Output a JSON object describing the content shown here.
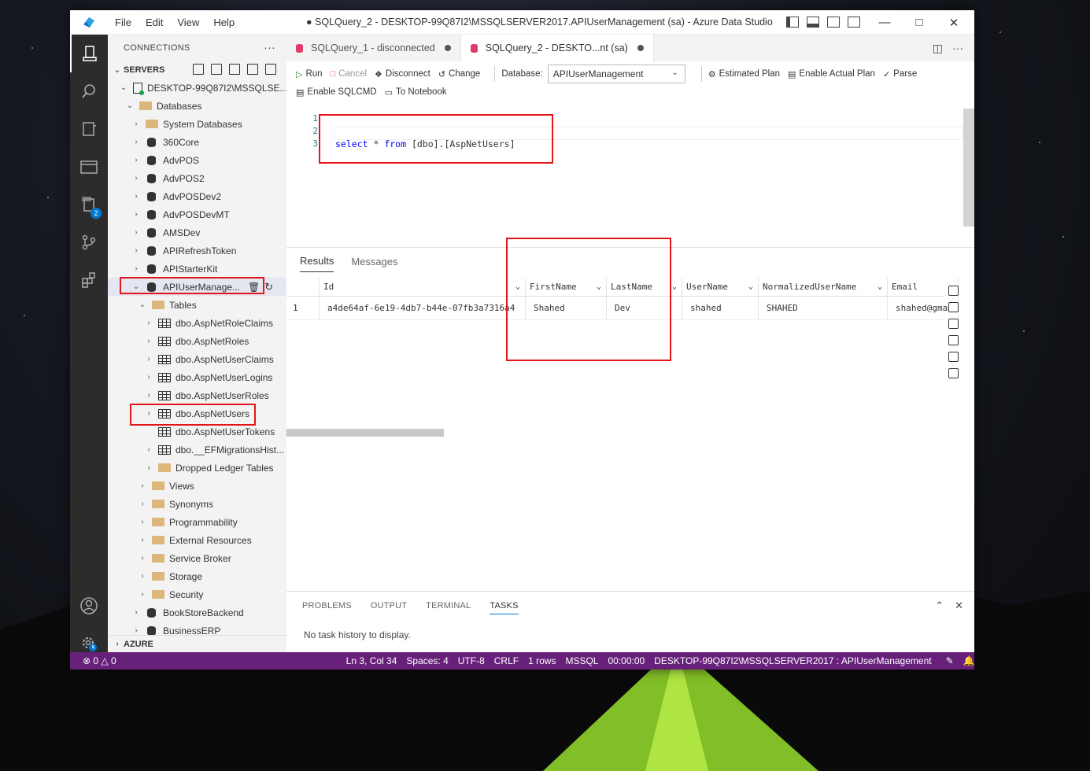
{
  "window": {
    "title": "● SQLQuery_2 - DESKTOP-99Q87I2\\MSSQLSERVER2017.APIUserManagement (sa) - Azure Data Studio",
    "menu": [
      "File",
      "Edit",
      "View",
      "Help"
    ]
  },
  "activity_bar": {
    "items": [
      "connections-icon",
      "search-icon",
      "notebooks-icon",
      "queries-icon",
      "explorer-icon",
      "source-control-icon",
      "extensions-icon"
    ],
    "explorer_badge": "2",
    "bottom": [
      "account-icon",
      "settings-icon"
    ]
  },
  "sidebar": {
    "header": "CONNECTIONS",
    "more": "···",
    "servers_label": "SERVERS",
    "server": "DESKTOP-99Q87I2\\MSSQLSE...",
    "databases_label": "Databases",
    "databases": [
      "System Databases",
      "360Core",
      "AdvPOS",
      "AdvPOS2",
      "AdvPOSDev2",
      "AdvPOSDevMT",
      "AMSDev",
      "APIRefreshToken",
      "APIStarterKit"
    ],
    "selected_db": "APIUserManage...",
    "tables_label": "Tables",
    "tables": [
      "dbo.AspNetRoleClaims",
      "dbo.AspNetRoles",
      "dbo.AspNetUserClaims",
      "dbo.AspNetUserLogins",
      "dbo.AspNetUserRoles",
      "dbo.AspNetUsers",
      "dbo.AspNetUserTokens",
      "dbo.__EFMigrationsHist...",
      "Dropped Ledger Tables"
    ],
    "db_folders": [
      "Views",
      "Synonyms",
      "Programmability",
      "External Resources",
      "Service Broker",
      "Storage",
      "Security"
    ],
    "more_dbs": [
      "BookStoreBackend",
      "BusinessERP"
    ],
    "azure_label": "AZURE"
  },
  "tabs": [
    {
      "label": "SQLQuery_1 - disconnected"
    },
    {
      "label": "SQLQuery_2 - DESKTO...nt (sa)"
    }
  ],
  "toolbar": {
    "run": "Run",
    "cancel": "Cancel",
    "disconnect": "Disconnect",
    "change": "Change",
    "database_label": "Database:",
    "database_value": "APIUserManagement",
    "estimated_plan": "Estimated Plan",
    "actual_plan": "Enable Actual Plan",
    "parse": "Parse",
    "sqlcmd": "Enable SQLCMD",
    "notebook": "To Notebook"
  },
  "editor": {
    "line_numbers": [
      "1",
      "2",
      "3"
    ],
    "code_select": "select",
    "code_star": " * ",
    "code_from": "from",
    "code_rest": " [dbo].[AspNetUsers]"
  },
  "results": {
    "tabs": [
      "Results",
      "Messages"
    ],
    "columns": [
      "Id",
      "FirstName",
      "LastName",
      "UserName",
      "NormalizedUserName",
      "Email"
    ],
    "rows": [
      {
        "num": "1",
        "cells": [
          "a4de64af-6e19-4db7-b44e-07fb3a7316a4",
          "Shahed",
          "Dev",
          "shahed",
          "SHAHED",
          "shahed@gma"
        ]
      }
    ]
  },
  "panel": {
    "tabs": [
      "PROBLEMS",
      "OUTPUT",
      "TERMINAL",
      "TASKS"
    ],
    "message": "No task history to display."
  },
  "status": {
    "errors": "0",
    "warnings": "0",
    "position": "Ln 3, Col 34",
    "spaces": "Spaces: 4",
    "encoding": "UTF-8",
    "eol": "CRLF",
    "rows": "1 rows",
    "language": "MSSQL",
    "time": "00:00:00",
    "connection": "DESKTOP-99Q87I2\\MSSQLSERVER2017 : APIUserManagement"
  },
  "colors": {
    "statusbar": "#68217a",
    "activitybar": "#2c2c2c",
    "highlight_box": "#e3151a"
  }
}
